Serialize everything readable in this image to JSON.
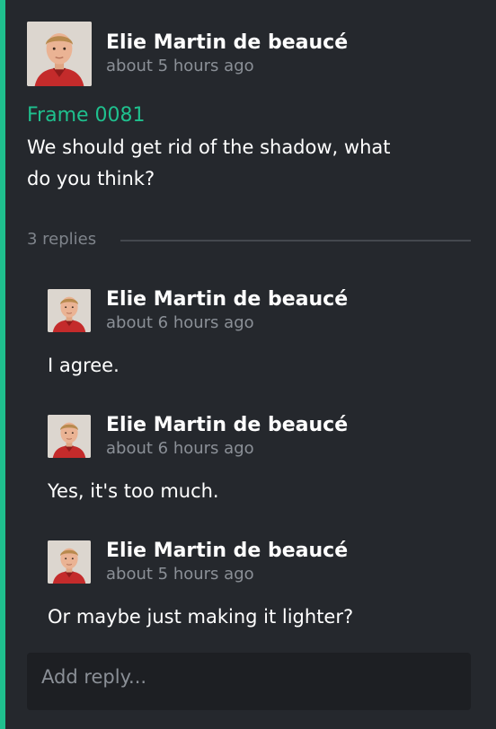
{
  "thread": {
    "accent_color": "#1fc08e",
    "comment": {
      "author": "Elie Martin de beaucé",
      "time": "about 5 hours ago",
      "frame_label": "Frame 0081",
      "text_line_1": "We should get rid of the shadow, what",
      "text_line_2": "do you think?"
    },
    "replies_label": "3 replies",
    "replies": [
      {
        "author": "Elie Martin de beaucé",
        "time": "about 6 hours ago",
        "text": "I agree."
      },
      {
        "author": "Elie Martin de beaucé",
        "time": "about 6 hours ago",
        "text": "Yes, it's too much."
      },
      {
        "author": "Elie Martin de beaucé",
        "time": "about 5 hours ago",
        "text": "Or maybe just making it lighter?"
      }
    ],
    "reply_input": {
      "placeholder": "Add reply...",
      "value": ""
    }
  }
}
